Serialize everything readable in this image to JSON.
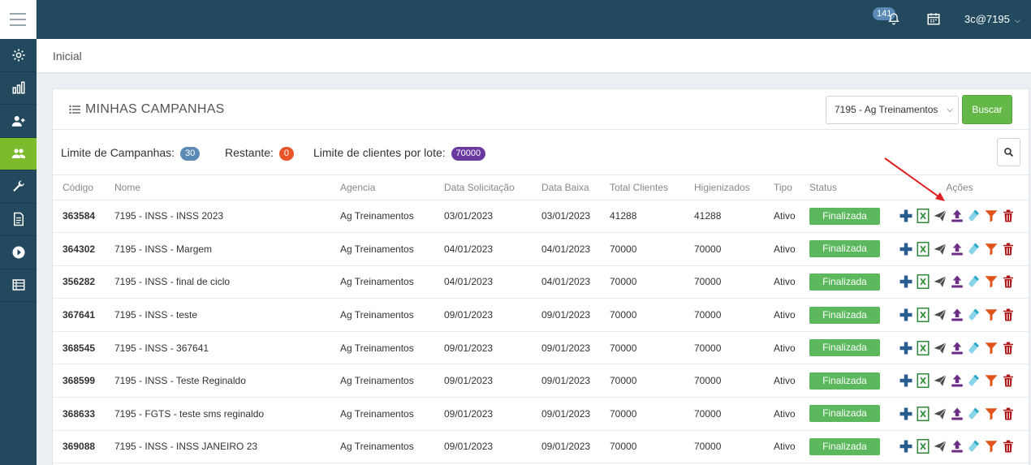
{
  "header": {
    "notification_count": "141",
    "user_label": "3c@7195"
  },
  "breadcrumb": {
    "current": "Inicial"
  },
  "sidebar": {
    "items": [
      {
        "icon": "gear-icon"
      },
      {
        "icon": "bar-chart-icon"
      },
      {
        "icon": "add-user-icon"
      },
      {
        "icon": "users-group-icon",
        "active": true
      },
      {
        "icon": "wrench-icon"
      },
      {
        "icon": "document-icon"
      },
      {
        "icon": "play-circle-icon"
      },
      {
        "icon": "list-icon"
      }
    ]
  },
  "card": {
    "title": "MINHAS CAMPANHAS",
    "agency_selected": "7195 - Ag Treinamentos",
    "search_button": "Buscar",
    "limits": {
      "campaigns_label": "Limite de Campanhas:",
      "campaigns_value": "30",
      "remaining_label": "Restante:",
      "remaining_value": "0",
      "clients_label": "Limite de clientes por lote:",
      "clients_value": "70000"
    }
  },
  "table": {
    "columns": [
      "Código",
      "Nome",
      "Agencia",
      "Data Solicitação",
      "Data Baixa",
      "Total Clientes",
      "Higienizados",
      "Tipo",
      "Status",
      "Ações"
    ],
    "rows": [
      {
        "code": "363584",
        "name": "7195 - INSS - INSS 2023",
        "agency": "Ag Treinamentos",
        "requested": "03/01/2023",
        "low": "03/01/2023",
        "total": "41288",
        "cleaned": "41288",
        "type": "Ativo",
        "status": "Finalizada"
      },
      {
        "code": "364302",
        "name": "7195 - INSS - Margem",
        "agency": "Ag Treinamentos",
        "requested": "04/01/2023",
        "low": "04/01/2023",
        "total": "70000",
        "cleaned": "70000",
        "type": "Ativo",
        "status": "Finalizada"
      },
      {
        "code": "356282",
        "name": "7195 - INSS - final de ciclo",
        "agency": "Ag Treinamentos",
        "requested": "04/01/2023",
        "low": "04/01/2023",
        "total": "70000",
        "cleaned": "70000",
        "type": "Ativo",
        "status": "Finalizada"
      },
      {
        "code": "367641",
        "name": "7195 - INSS - teste",
        "agency": "Ag Treinamentos",
        "requested": "09/01/2023",
        "low": "09/01/2023",
        "total": "70000",
        "cleaned": "70000",
        "type": "Ativo",
        "status": "Finalizada"
      },
      {
        "code": "368545",
        "name": "7195 - INSS - 367641",
        "agency": "Ag Treinamentos",
        "requested": "09/01/2023",
        "low": "09/01/2023",
        "total": "70000",
        "cleaned": "70000",
        "type": "Ativo",
        "status": "Finalizada"
      },
      {
        "code": "368599",
        "name": "7195 - INSS - Teste Reginaldo",
        "agency": "Ag Treinamentos",
        "requested": "09/01/2023",
        "low": "09/01/2023",
        "total": "70000",
        "cleaned": "70000",
        "type": "Ativo",
        "status": "Finalizada"
      },
      {
        "code": "368633",
        "name": "7195 - FGTS - teste sms reginaldo",
        "agency": "Ag Treinamentos",
        "requested": "09/01/2023",
        "low": "09/01/2023",
        "total": "70000",
        "cleaned": "70000",
        "type": "Ativo",
        "status": "Finalizada"
      },
      {
        "code": "369088",
        "name": "7195 - INSS - INSS JANEIRO 23",
        "agency": "Ag Treinamentos",
        "requested": "09/01/2023",
        "low": "09/01/2023",
        "total": "70000",
        "cleaned": "70000",
        "type": "Ativo",
        "status": "Finalizada"
      }
    ]
  },
  "colors": {
    "sidebar": "#22495e",
    "active": "#7cbb2c",
    "status": "#5bb85d",
    "badge_campaigns": "#5a8ab5",
    "badge_remaining": "#e8552b",
    "badge_clients": "#6a3aa0",
    "annotation_arrow": "#e02020"
  }
}
